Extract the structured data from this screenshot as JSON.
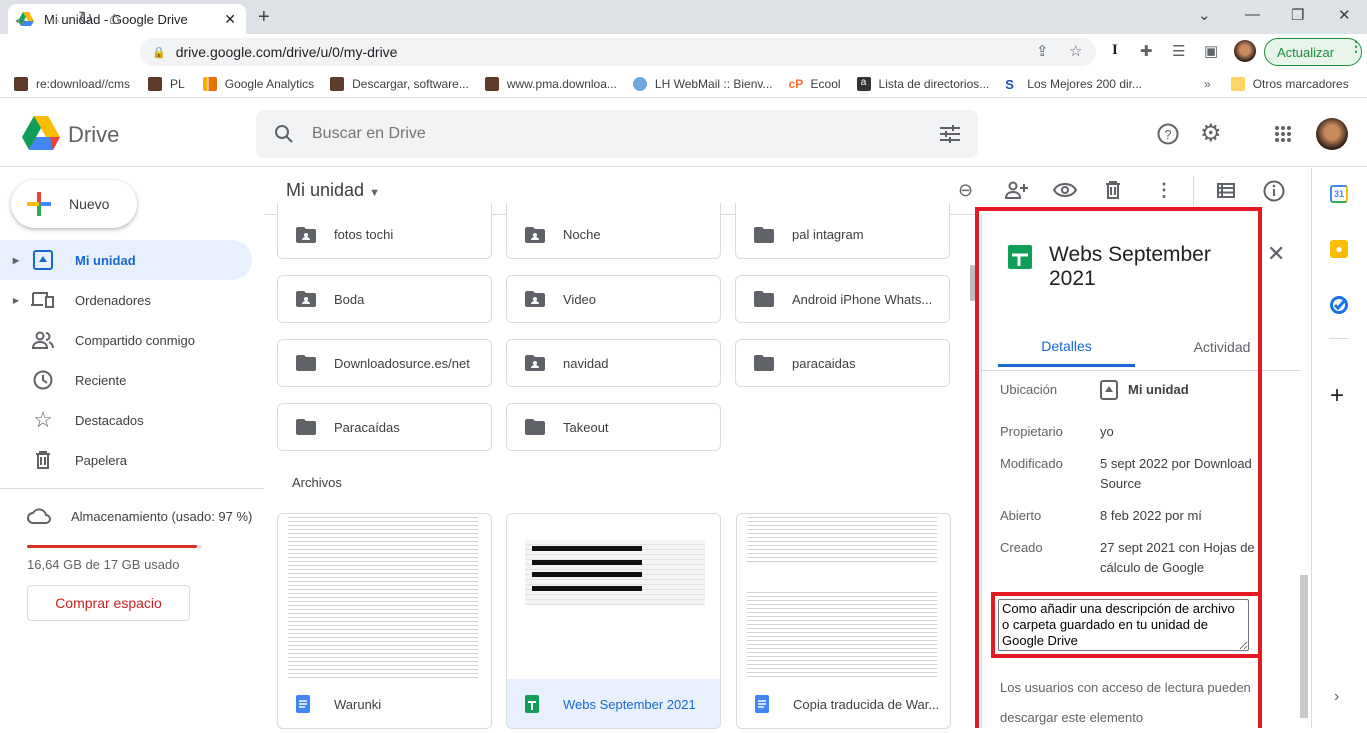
{
  "browser": {
    "tab_title": "Mi unidad - Google Drive",
    "url": "drive.google.com/drive/u/0/my-drive",
    "update_label": "Actualizar",
    "bookmarks": [
      {
        "label": "re:download//cms",
        "icon": "bookmark-orange-icon"
      },
      {
        "label": "PL",
        "icon": "bookmark-orange-icon"
      },
      {
        "label": "Google Analytics",
        "icon": "analytics-icon"
      },
      {
        "label": "Descargar, software...",
        "icon": "bookmark-orange-icon"
      },
      {
        "label": "www.pma.downloa...",
        "icon": "bookmark-orange-icon"
      },
      {
        "label": "LH WebMail :: Bienv...",
        "icon": "webmail-icon"
      },
      {
        "label": "Ecool",
        "icon": "ecool-icon"
      },
      {
        "label": "Lista de directorios...",
        "icon": "amazon-icon"
      },
      {
        "label": "Los Mejores 200 dir...",
        "icon": "s-icon"
      }
    ],
    "more_bookmarks": "»",
    "other_bookmarks": "Otros marcadores"
  },
  "drive": {
    "logo_text": "Drive",
    "search_placeholder": "Buscar en Drive",
    "new_button": "Nuevo",
    "nav": [
      {
        "label": "Mi unidad",
        "active": true
      },
      {
        "label": "Ordenadores"
      },
      {
        "label": "Compartido conmigo"
      },
      {
        "label": "Reciente"
      },
      {
        "label": "Destacados"
      },
      {
        "label": "Papelera"
      }
    ],
    "storage": {
      "label": "Almacenamiento (usado: 97 %)",
      "used_text": "16,64 GB de 17 GB usado",
      "used_fraction": 0.97,
      "buy_button": "Comprar espacio"
    },
    "main_title": "Mi unidad",
    "folders": [
      {
        "name": "fotos tochi",
        "shared": true
      },
      {
        "name": "Noche",
        "shared": true
      },
      {
        "name": "pal intagram",
        "shared": false
      },
      {
        "name": "Boda",
        "shared": true
      },
      {
        "name": "Video",
        "shared": true
      },
      {
        "name": "Android iPhone Whats...",
        "shared": false
      },
      {
        "name": "Downloadosurce.es/net",
        "shared": false
      },
      {
        "name": "navidad",
        "shared": true
      },
      {
        "name": "paracaidas",
        "shared": false
      },
      {
        "name": "Paracaídas",
        "shared": false
      },
      {
        "name": "Takeout",
        "shared": false
      }
    ],
    "files_heading": "Archivos",
    "files": [
      {
        "name": "Warunki",
        "type": "doc"
      },
      {
        "name": "Webs September 2021",
        "type": "sheet",
        "selected": true
      },
      {
        "name": "Copia traducida de War...",
        "type": "doc"
      }
    ]
  },
  "details": {
    "title": "Webs September 2021",
    "tabs": [
      "Detalles",
      "Actividad"
    ],
    "rows": [
      {
        "label": "Ubicación",
        "value": "Mi unidad"
      },
      {
        "label": "Propietario",
        "value": "yo"
      },
      {
        "label": "Modificado",
        "value": "5 sept 2022 por Download Source"
      },
      {
        "label": "Abierto",
        "value": "8 feb 2022 por mí"
      },
      {
        "label": "Creado",
        "value": "27 sept 2021 con Hojas de cálculo de Google"
      }
    ],
    "description": "Como añadir una descripción de archivo o carpeta guardado en tu unidad de Google Drive",
    "download_note": "Los usuarios con acceso de lectura pueden descargar este elemento"
  },
  "colors": {
    "accent": "#1967d2",
    "highlight": "#e31a23",
    "storage_bar": "#d93025"
  }
}
